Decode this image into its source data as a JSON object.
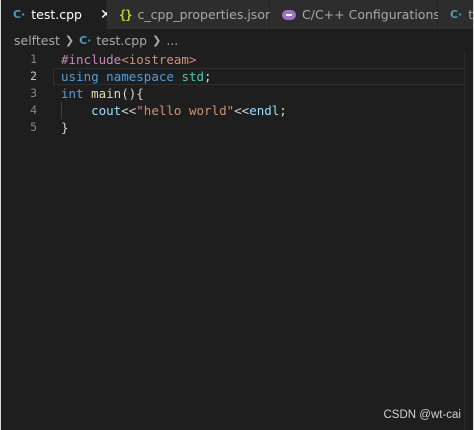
{
  "tabs": [
    {
      "label": "test.cpp",
      "icon": "cpp-file-icon",
      "close": "✕"
    },
    {
      "label": "c_cpp_properties.json",
      "icon": "json-file-icon"
    },
    {
      "label": "C/C++ Configurations",
      "icon": "configurations-icon"
    },
    {
      "label": "th",
      "icon": "cpp-file-icon"
    }
  ],
  "breadcrumb": {
    "folder": "selftest",
    "file": "test.cpp",
    "more": "..."
  },
  "line_numbers": [
    "1",
    "2",
    "3",
    "4",
    "5"
  ],
  "code": {
    "line1": {
      "directive": "#include",
      "lib": "<iostream>"
    },
    "line2": {
      "kw1": "using",
      "kw2": "namespace",
      "ns": "std",
      "end": ";"
    },
    "line3": {
      "kw": "int",
      "fn": "main",
      "rest": "(){"
    },
    "line4": {
      "indent": "    ",
      "id1": "cout",
      "op1": "<<",
      "str": "\"hello world\"",
      "op2": "<<",
      "id2": "endl",
      "end": ";"
    },
    "line5": {
      "brace": "}"
    }
  },
  "watermark": "CSDN @wt-cai",
  "colors": {
    "editor_bg": "#1e1e1e",
    "tab_bar_bg": "#252526",
    "keyword": "#569cd6",
    "preprocessor": "#c586c0",
    "string": "#ce9178",
    "function": "#dcdcaa",
    "variable": "#9cdcfe",
    "namespace": "#4ec9b0"
  }
}
